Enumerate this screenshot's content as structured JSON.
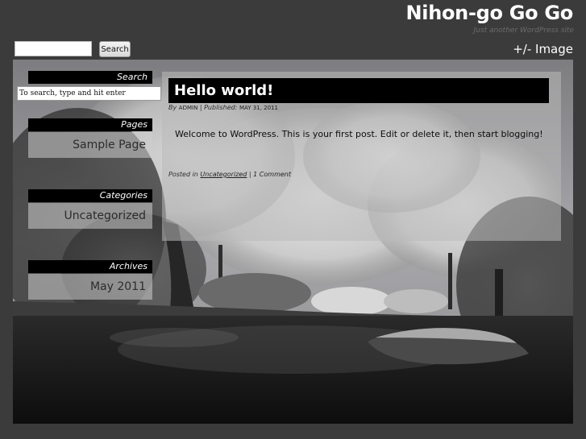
{
  "site": {
    "title": "Nihon-go Go Go",
    "tagline": "Just another WordPress site"
  },
  "top_search": {
    "value": "",
    "button_label": "Search"
  },
  "image_toggle": "+/- Image",
  "sidebar": {
    "search": {
      "title": "Search",
      "input_value": "To search, type and hit enter"
    },
    "pages": {
      "title": "Pages",
      "items": [
        "Sample Page"
      ]
    },
    "categories": {
      "title": "Categories",
      "items": [
        "Uncategorized"
      ]
    },
    "archives": {
      "title": "Archives",
      "items": [
        "May 2011"
      ]
    }
  },
  "post": {
    "title": "Hello world!",
    "by_label": "By",
    "author": "ADMIN",
    "published_label": "| Published:",
    "date": "MAY 31, 2011",
    "body": "Welcome to WordPress. This is your first post. Edit or delete it, then start blogging!",
    "posted_in_label": "Posted in",
    "category": "Uncategorized",
    "separator": "|",
    "comments": "1 Comment"
  }
}
